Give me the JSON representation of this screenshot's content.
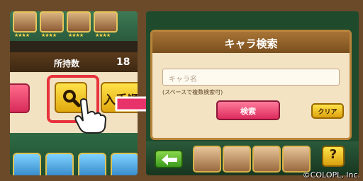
{
  "left_panel": {
    "owned_label": "所持数",
    "owned_value": "18",
    "sort_button_label": "入手順"
  },
  "right_panel": {
    "dialog_title": "キャラ検索",
    "name_input_placeholder": "キャラ名",
    "hint": "(スペースで複数検索可)",
    "search_button_label": "検索",
    "clear_button_label": "クリア",
    "help_button_label": "?"
  },
  "icons": [
    "search-icon",
    "pointing-hand-icon",
    "right-arrow-icon",
    "back-arrow-icon",
    "help-icon"
  ],
  "colors": {
    "highlight": "#e8323c",
    "primary_button": "#dc2c5e",
    "yellow_button": "#e0a80e",
    "arrow": "#e8326a"
  },
  "copyright": "©COLOPL, Inc."
}
